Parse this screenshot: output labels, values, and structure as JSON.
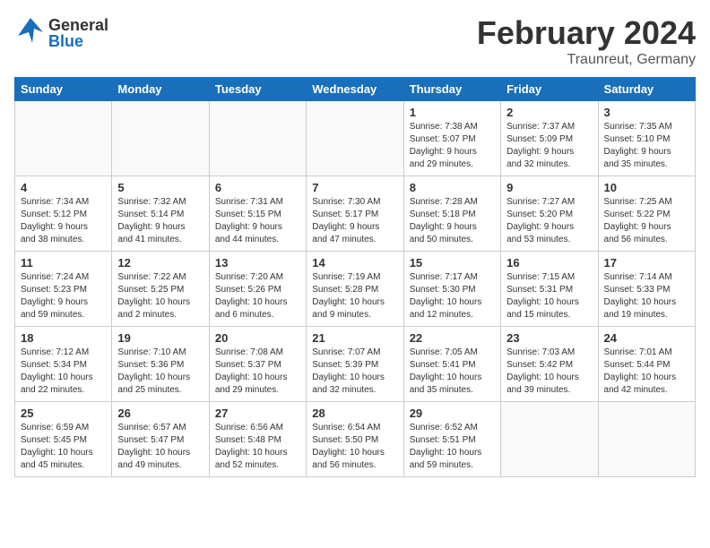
{
  "header": {
    "logo_general": "General",
    "logo_blue": "Blue",
    "month_title": "February 2024",
    "location": "Traunreut, Germany"
  },
  "weekdays": [
    "Sunday",
    "Monday",
    "Tuesday",
    "Wednesday",
    "Thursday",
    "Friday",
    "Saturday"
  ],
  "weeks": [
    [
      {
        "day": "",
        "info": ""
      },
      {
        "day": "",
        "info": ""
      },
      {
        "day": "",
        "info": ""
      },
      {
        "day": "",
        "info": ""
      },
      {
        "day": "1",
        "info": "Sunrise: 7:38 AM\nSunset: 5:07 PM\nDaylight: 9 hours\nand 29 minutes."
      },
      {
        "day": "2",
        "info": "Sunrise: 7:37 AM\nSunset: 5:09 PM\nDaylight: 9 hours\nand 32 minutes."
      },
      {
        "day": "3",
        "info": "Sunrise: 7:35 AM\nSunset: 5:10 PM\nDaylight: 9 hours\nand 35 minutes."
      }
    ],
    [
      {
        "day": "4",
        "info": "Sunrise: 7:34 AM\nSunset: 5:12 PM\nDaylight: 9 hours\nand 38 minutes."
      },
      {
        "day": "5",
        "info": "Sunrise: 7:32 AM\nSunset: 5:14 PM\nDaylight: 9 hours\nand 41 minutes."
      },
      {
        "day": "6",
        "info": "Sunrise: 7:31 AM\nSunset: 5:15 PM\nDaylight: 9 hours\nand 44 minutes."
      },
      {
        "day": "7",
        "info": "Sunrise: 7:30 AM\nSunset: 5:17 PM\nDaylight: 9 hours\nand 47 minutes."
      },
      {
        "day": "8",
        "info": "Sunrise: 7:28 AM\nSunset: 5:18 PM\nDaylight: 9 hours\nand 50 minutes."
      },
      {
        "day": "9",
        "info": "Sunrise: 7:27 AM\nSunset: 5:20 PM\nDaylight: 9 hours\nand 53 minutes."
      },
      {
        "day": "10",
        "info": "Sunrise: 7:25 AM\nSunset: 5:22 PM\nDaylight: 9 hours\nand 56 minutes."
      }
    ],
    [
      {
        "day": "11",
        "info": "Sunrise: 7:24 AM\nSunset: 5:23 PM\nDaylight: 9 hours\nand 59 minutes."
      },
      {
        "day": "12",
        "info": "Sunrise: 7:22 AM\nSunset: 5:25 PM\nDaylight: 10 hours\nand 2 minutes."
      },
      {
        "day": "13",
        "info": "Sunrise: 7:20 AM\nSunset: 5:26 PM\nDaylight: 10 hours\nand 6 minutes."
      },
      {
        "day": "14",
        "info": "Sunrise: 7:19 AM\nSunset: 5:28 PM\nDaylight: 10 hours\nand 9 minutes."
      },
      {
        "day": "15",
        "info": "Sunrise: 7:17 AM\nSunset: 5:30 PM\nDaylight: 10 hours\nand 12 minutes."
      },
      {
        "day": "16",
        "info": "Sunrise: 7:15 AM\nSunset: 5:31 PM\nDaylight: 10 hours\nand 15 minutes."
      },
      {
        "day": "17",
        "info": "Sunrise: 7:14 AM\nSunset: 5:33 PM\nDaylight: 10 hours\nand 19 minutes."
      }
    ],
    [
      {
        "day": "18",
        "info": "Sunrise: 7:12 AM\nSunset: 5:34 PM\nDaylight: 10 hours\nand 22 minutes."
      },
      {
        "day": "19",
        "info": "Sunrise: 7:10 AM\nSunset: 5:36 PM\nDaylight: 10 hours\nand 25 minutes."
      },
      {
        "day": "20",
        "info": "Sunrise: 7:08 AM\nSunset: 5:37 PM\nDaylight: 10 hours\nand 29 minutes."
      },
      {
        "day": "21",
        "info": "Sunrise: 7:07 AM\nSunset: 5:39 PM\nDaylight: 10 hours\nand 32 minutes."
      },
      {
        "day": "22",
        "info": "Sunrise: 7:05 AM\nSunset: 5:41 PM\nDaylight: 10 hours\nand 35 minutes."
      },
      {
        "day": "23",
        "info": "Sunrise: 7:03 AM\nSunset: 5:42 PM\nDaylight: 10 hours\nand 39 minutes."
      },
      {
        "day": "24",
        "info": "Sunrise: 7:01 AM\nSunset: 5:44 PM\nDaylight: 10 hours\nand 42 minutes."
      }
    ],
    [
      {
        "day": "25",
        "info": "Sunrise: 6:59 AM\nSunset: 5:45 PM\nDaylight: 10 hours\nand 45 minutes."
      },
      {
        "day": "26",
        "info": "Sunrise: 6:57 AM\nSunset: 5:47 PM\nDaylight: 10 hours\nand 49 minutes."
      },
      {
        "day": "27",
        "info": "Sunrise: 6:56 AM\nSunset: 5:48 PM\nDaylight: 10 hours\nand 52 minutes."
      },
      {
        "day": "28",
        "info": "Sunrise: 6:54 AM\nSunset: 5:50 PM\nDaylight: 10 hours\nand 56 minutes."
      },
      {
        "day": "29",
        "info": "Sunrise: 6:52 AM\nSunset: 5:51 PM\nDaylight: 10 hours\nand 59 minutes."
      },
      {
        "day": "",
        "info": ""
      },
      {
        "day": "",
        "info": ""
      }
    ]
  ]
}
